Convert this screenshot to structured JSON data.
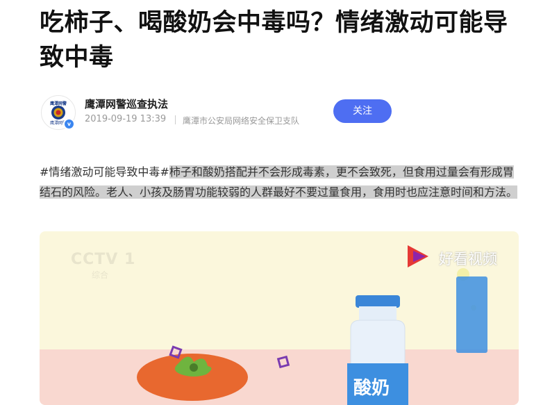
{
  "article": {
    "title": "吃柿子、喝酸奶会中毒吗？情绪激动可能导致中毒",
    "author": {
      "name": "鹰潭网警巡查执法",
      "avatar_text_top": "鹰潭网警",
      "avatar_text_bottom": "鹰潭网警",
      "verified_badge": "v",
      "date": "2019-09-19 13:39",
      "org": "鹰潭市公安局网络安全保卫支队"
    },
    "follow_label": "关注",
    "hashtag": "#情绪激动可能导致中毒#",
    "body": "柿子和酸奶搭配并不会形成毒素，更不会致死，但食用过量会有形成胃结石的风险。老人、小孩及肠胃功能较弱的人群最好不要过量食用，食用时也应注意时间和方法。"
  },
  "video": {
    "channel_logo": "CCTV 1",
    "channel_sub": "综合",
    "watermark": "好看视频",
    "bottle_label": "酸奶",
    "colors": {
      "bg": "#fbf7dc",
      "floor": "#f9d8d0",
      "persimmon": "#e8682f",
      "bottle": "#3d8fe0"
    }
  }
}
